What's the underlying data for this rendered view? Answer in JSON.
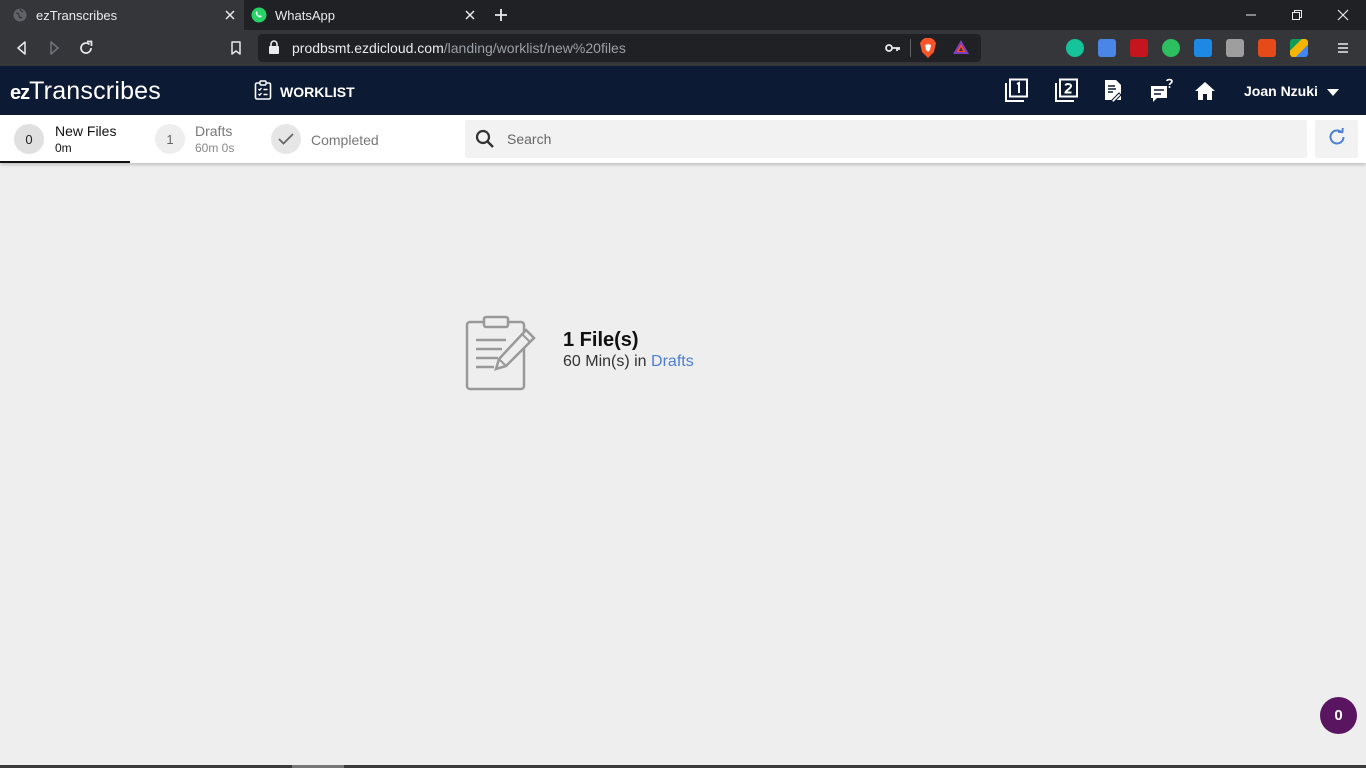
{
  "browser": {
    "tabs": [
      {
        "title": "ezTranscribes",
        "active": true,
        "icon": "globe-icon"
      },
      {
        "title": "WhatsApp",
        "active": false,
        "icon": "whatsapp-icon"
      }
    ],
    "url_host": "prodbsmt.ezdicloud.com",
    "url_path": "/landing/worklist/new%20files",
    "colors": {
      "tabbar": "#202124",
      "toolbar": "#35363a"
    }
  },
  "app": {
    "logo_prefix": "ez",
    "logo_name": "Transcribes",
    "nav_worklist": "WORKLIST",
    "header_icons": [
      "single-doc-1-icon",
      "multi-doc-2-icon",
      "document-edit-icon",
      "chat-help-icon",
      "home-icon"
    ],
    "user_name": "Joan Nzuki",
    "colors": {
      "header": "#0c1a33",
      "link": "#4a7fd4",
      "fab": "#5a1560"
    }
  },
  "worklist": {
    "tabs": [
      {
        "badge": "0",
        "label": "New Files",
        "sub": "0m",
        "active": true
      },
      {
        "badge": "1",
        "label": "Drafts",
        "sub": "60m 0s",
        "active": false
      },
      {
        "label": "Completed",
        "active": false,
        "icon": "check-icon"
      }
    ],
    "search_placeholder": "Search"
  },
  "summary": {
    "count_text": "1 File(s)",
    "mins_text": "60 Min(s) in ",
    "link_text": "Drafts"
  },
  "notifications_count": "0"
}
